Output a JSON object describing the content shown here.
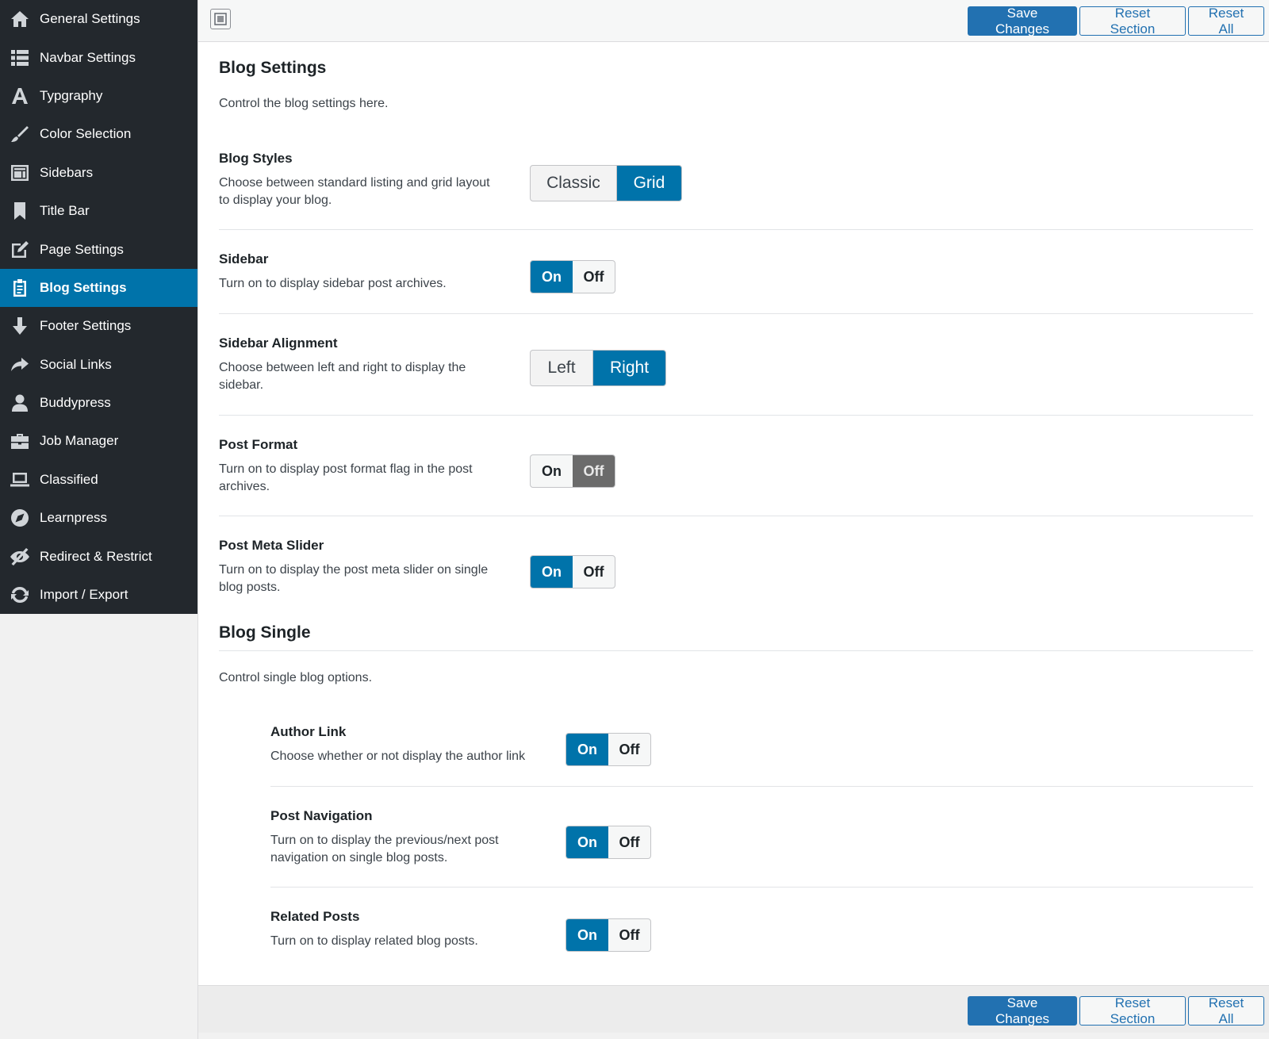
{
  "sidebar": {
    "items": [
      {
        "label": "General Settings",
        "icon": "home-icon",
        "active": false
      },
      {
        "label": "Navbar Settings",
        "icon": "list-icon",
        "active": false
      },
      {
        "label": "Typgraphy",
        "icon": "font-icon",
        "active": false
      },
      {
        "label": "Color Selection",
        "icon": "brush-icon",
        "active": false
      },
      {
        "label": "Sidebars",
        "icon": "layout-icon",
        "active": false
      },
      {
        "label": "Title Bar",
        "icon": "bookmark-icon",
        "active": false
      },
      {
        "label": "Page Settings",
        "icon": "edit-icon",
        "active": false
      },
      {
        "label": "Blog Settings",
        "icon": "clipboard-icon",
        "active": true
      },
      {
        "label": "Footer Settings",
        "icon": "arrow-down-icon",
        "active": false
      },
      {
        "label": "Social Links",
        "icon": "share-icon",
        "active": false
      },
      {
        "label": "Buddypress",
        "icon": "user-icon",
        "active": false
      },
      {
        "label": "Job Manager",
        "icon": "briefcase-icon",
        "active": false
      },
      {
        "label": "Classified",
        "icon": "laptop-icon",
        "active": false
      },
      {
        "label": "Learnpress",
        "icon": "compass-icon",
        "active": false
      },
      {
        "label": "Redirect & Restrict",
        "icon": "hidden-icon",
        "active": false
      },
      {
        "label": "Import / Export",
        "icon": "refresh-icon",
        "active": false
      }
    ]
  },
  "toolbar": {
    "save_label": "Save Changes",
    "reset_section_label": "Reset Section",
    "reset_all_label": "Reset All"
  },
  "blog_settings": {
    "title": "Blog Settings",
    "description": "Control the blog settings here.",
    "blog_styles": {
      "title": "Blog Styles",
      "desc_line1": "Choose between standard listing and grid layout",
      "desc_line2": "to display your blog.",
      "options": [
        "Classic",
        "Grid"
      ],
      "selected": "Grid"
    },
    "sidebar": {
      "title": "Sidebar",
      "desc_line1": "Turn on to display sidebar post archives.",
      "on_label": "On",
      "off_label": "Off",
      "value": "On"
    },
    "sidebar_alignment": {
      "title": "Sidebar Alignment",
      "desc_line1": "Choose between left and right to display the",
      "desc_line2": "sidebar.",
      "options": [
        "Left",
        "Right"
      ],
      "selected": "Right"
    },
    "post_format": {
      "title": "Post Format",
      "desc_line1": "Turn on to display post format flag in the post",
      "desc_line2": "archives.",
      "on_label": "On",
      "off_label": "Off",
      "value": "Off"
    },
    "post_meta_slider": {
      "title": "Post Meta Slider",
      "desc_line1": "Turn on to display the post meta slider on single",
      "desc_line2": "blog posts.",
      "on_label": "On",
      "off_label": "Off",
      "value": "On"
    }
  },
  "blog_single": {
    "title": "Blog Single",
    "description": "Control single blog options.",
    "author_link": {
      "title": "Author Link",
      "desc_line1": "Choose whether or not display the author link",
      "on_label": "On",
      "off_label": "Off",
      "value": "On"
    },
    "post_navigation": {
      "title": "Post Navigation",
      "desc_line1": "Turn on to display the previous/next post",
      "desc_line2": "navigation on single blog posts.",
      "on_label": "On",
      "off_label": "Off",
      "value": "On"
    },
    "related_posts": {
      "title": "Related Posts",
      "desc_line1": "Turn on to display related blog posts.",
      "on_label": "On",
      "off_label": "Off",
      "value": "On"
    }
  },
  "colors": {
    "accent": "#0073aa",
    "sidebar_bg": "#23282d",
    "button_primary": "#2271b1"
  }
}
